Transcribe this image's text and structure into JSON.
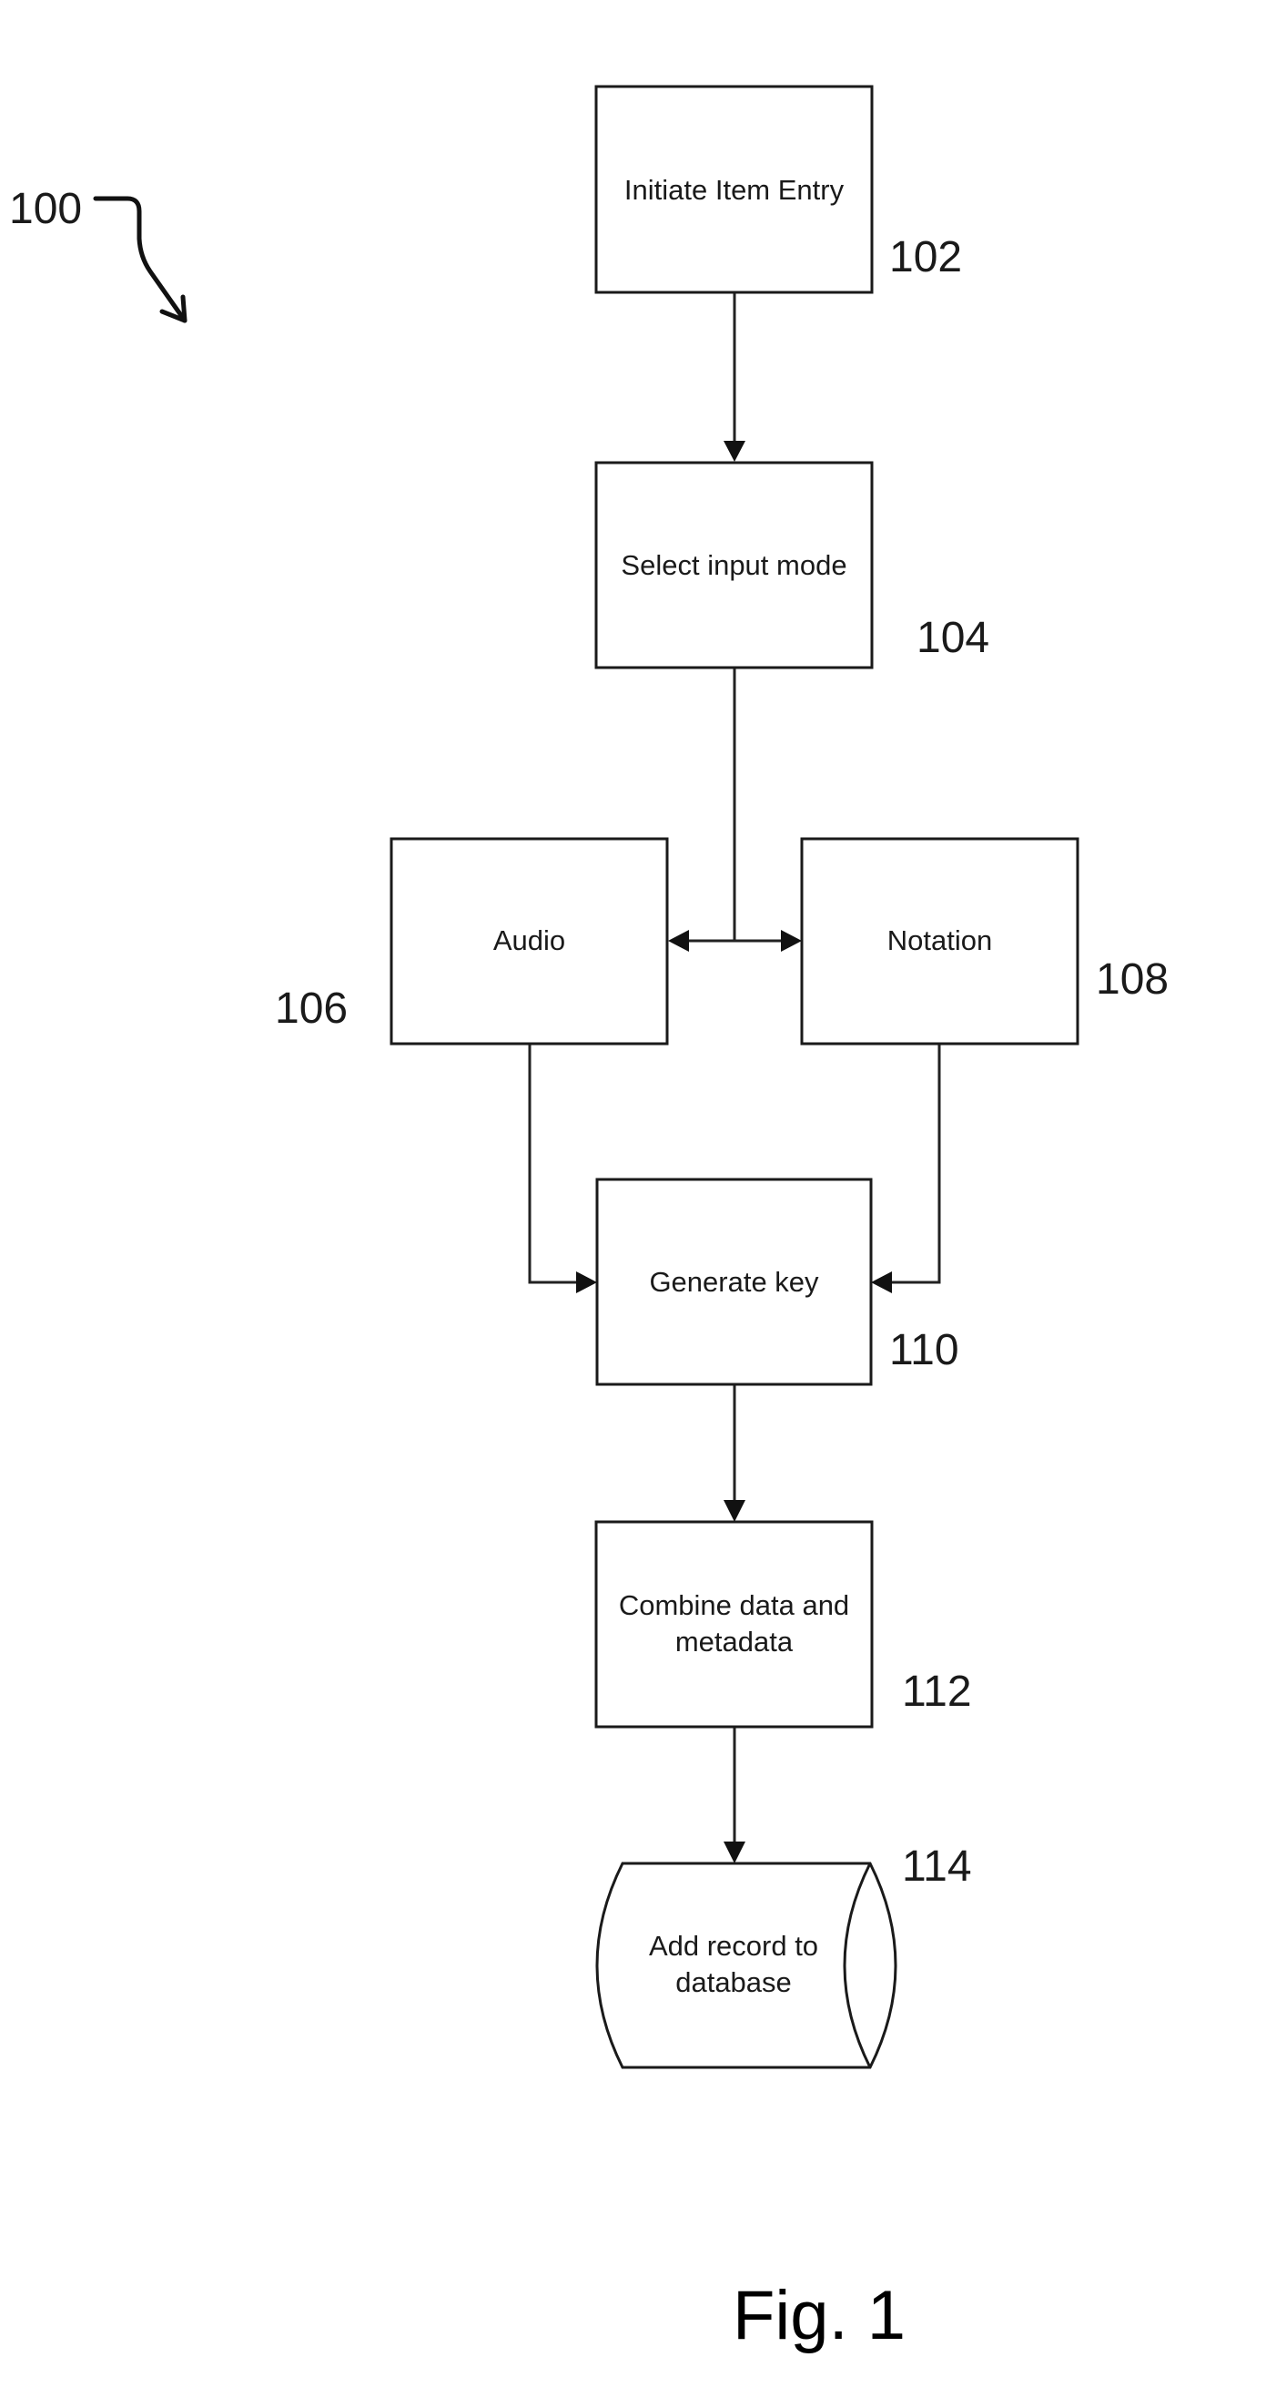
{
  "figure": {
    "caption": "Fig. 1",
    "reference": "100",
    "colors": {
      "ink": "#1a1a1a",
      "background": "#ffffff"
    }
  },
  "nodes": [
    {
      "id": "102",
      "lines": [
        "Initiate Item Entry"
      ],
      "shape": "process"
    },
    {
      "id": "104",
      "lines": [
        "Select input mode"
      ],
      "shape": "process"
    },
    {
      "id": "106",
      "lines": [
        "Audio"
      ],
      "shape": "process"
    },
    {
      "id": "108",
      "lines": [
        "Notation"
      ],
      "shape": "process"
    },
    {
      "id": "110",
      "lines": [
        "Generate key"
      ],
      "shape": "process"
    },
    {
      "id": "112",
      "lines": [
        "Combine data and",
        "metadata"
      ],
      "shape": "process"
    },
    {
      "id": "114",
      "lines": [
        "Add record to",
        "database"
      ],
      "shape": "database"
    }
  ],
  "edges": [
    {
      "from": "102",
      "to": "104"
    },
    {
      "from": "104",
      "to": "106"
    },
    {
      "from": "104",
      "to": "108"
    },
    {
      "from": "106",
      "to": "110"
    },
    {
      "from": "108",
      "to": "110"
    },
    {
      "from": "110",
      "to": "112"
    },
    {
      "from": "112",
      "to": "114"
    }
  ]
}
